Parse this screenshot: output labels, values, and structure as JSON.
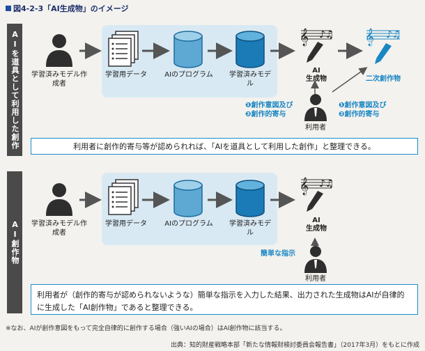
{
  "figure_title": "図4-2-3「AI生成物」のイメージ",
  "colors": {
    "accent": "#1a86c4",
    "panel": "#d8e9f3",
    "dark": "#4a4a4a",
    "title": "#1d2f6b"
  },
  "section1": {
    "side_label": "AIを道具として利用した創作",
    "creator": "学習済みモデル作成者",
    "training_data": "学習用データ",
    "ai_program": "AIのプログラム",
    "trained_model": "学習済みモデル",
    "ai_output_line1": "AI",
    "ai_output_line2": "生成物",
    "derivative": "二次創作物",
    "user": "利用者",
    "left_annot": [
      "❶創作意図及び",
      "❷創作的寄与"
    ],
    "right_annot": [
      "❶創作意図及び",
      "❷創作的寄与"
    ],
    "conclusion": "利用者に創作的寄与等が認められれば、「AIを道具として利用した創作」と整理できる。"
  },
  "section2": {
    "side_label": "AI創作物",
    "creator": "学習済みモデル作成者",
    "training_data": "学習用データ",
    "ai_program": "AIのプログラム",
    "trained_model": "学習済みモデル",
    "ai_output_line1": "AI",
    "ai_output_line2": "生成物",
    "instruction": "簡単な指示",
    "user": "利用者",
    "conclusion": "利用者が（創作的寄与が認められないような）簡単な指示を入力した結果、出力された生成物はAIが自律的に生成した「AI創作物」であると整理できる。"
  },
  "footnote": "※なお、AIが創作意図をもって完全自律的に創作する場合（強いAIの場合）はAI創作物に該当する。",
  "source": "出典：知的財産戦略本部「新たな情報財検討委員会報告書」（2017年3月）をもとに作成"
}
